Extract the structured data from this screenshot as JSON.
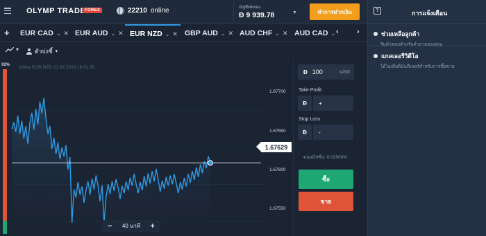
{
  "header": {
    "logo": "OLYMP TRADE",
    "logo_badge": "FOREX",
    "online_count": "22210",
    "online_label": "online",
    "account_label": "บัญชีทดลอง",
    "balance": "Ð 9 939.78",
    "deposit_label": "ทำการฝากเงิน"
  },
  "tabs": [
    {
      "label": "EUR CAD",
      "active": false
    },
    {
      "label": "EUR AUD",
      "active": false
    },
    {
      "label": "EUR NZD",
      "active": true
    },
    {
      "label": "GBP AUD",
      "active": false
    },
    {
      "label": "AUD CHF",
      "active": false
    },
    {
      "label": "AUD CAD",
      "active": false
    }
  ],
  "toolbar": {
    "indicators_label": "ตัวบ่งชี้"
  },
  "chart": {
    "caption": "online EUR NZD 21.02.2018 16:01:50",
    "percent_label": "92%",
    "current_price_label": "1.67629",
    "time_frame_label": "40 นาที",
    "y_ticks": [
      "1.67700",
      "1.67650",
      "1.67600",
      "1.67550"
    ]
  },
  "trade_panel": {
    "currency_symbol": "Ð",
    "amount": "100",
    "multiplier": "x200",
    "take_profit_label": "Take Profit",
    "stop_loss_label": "Stop Loss",
    "plus_sign": "+",
    "minus_sign": "-",
    "commission": "คอมมิชชั่น: 0.02500%",
    "buy_label": "ซื้อ",
    "sell_label": "ขาย"
  },
  "notifications": {
    "title": "การแจ้งเตือน",
    "items": [
      {
        "title": "ช่วยเหลือลูกค้า",
        "subtitle": "รับคำตอบสำหรับคำถามของคุณ"
      },
      {
        "title": "แกลเลอรีวิดีโอ",
        "subtitle": "ได้ไอเดียดีมันฟีเจอร์สำหรับการซื้อขาย"
      }
    ]
  },
  "colors": {
    "accent_blue": "#2f9be4",
    "deposit_orange": "#f39d1c",
    "buy_green": "#1fa773",
    "sell_red": "#e05438",
    "line_blue": "#2f9be4"
  },
  "icons": [
    "menu-icon",
    "globe-icon",
    "chevron-down-icon",
    "close-icon",
    "chevron-left-icon",
    "chevron-right-icon",
    "line-chart-icon",
    "person-icon",
    "help-icon",
    "chat-bubble-icon"
  ],
  "chart_data": {
    "type": "line",
    "ylim": [
      1.6753,
      1.6777
    ],
    "current_value": 1.67629,
    "x": [
      0,
      1,
      2,
      3,
      4,
      5,
      6,
      7,
      8,
      9,
      10,
      11,
      12,
      13,
      14,
      15,
      16,
      17,
      18,
      19,
      20,
      21,
      22,
      23,
      24,
      25,
      26,
      27,
      28,
      29,
      30,
      31,
      32,
      33,
      34,
      35,
      36,
      37,
      38,
      39,
      40,
      41,
      42,
      43,
      44,
      45,
      46,
      47,
      48,
      49,
      50,
      51,
      52,
      53,
      54,
      55,
      56,
      57,
      58,
      59,
      60,
      61,
      62,
      63,
      64,
      65,
      66,
      67,
      68,
      69,
      70,
      71,
      72,
      73,
      74,
      75,
      76,
      77,
      78,
      79,
      80,
      81,
      82,
      83,
      84,
      85,
      86,
      87,
      88,
      89,
      90,
      91,
      92,
      93,
      94,
      95,
      96,
      97,
      98,
      99
    ],
    "series": [
      {
        "values": [
          1.67675,
          1.67684,
          1.67671,
          1.67693,
          1.67668,
          1.67686,
          1.67662,
          1.67679,
          1.67655,
          1.67683,
          1.67697,
          1.67674,
          1.67702,
          1.67681,
          1.67712,
          1.67696,
          1.67717,
          1.6769,
          1.67668,
          1.67679,
          1.67648,
          1.67663,
          1.67641,
          1.67657,
          1.67634,
          1.6765,
          1.67638,
          1.67653,
          1.6762,
          1.67637,
          1.67548,
          1.67593,
          1.67582,
          1.67603,
          1.67586,
          1.67597,
          1.67575,
          1.67592,
          1.67604,
          1.67586,
          1.67608,
          1.67593,
          1.67612,
          1.67598,
          1.67577,
          1.67599,
          1.67548,
          1.67583,
          1.676,
          1.67587,
          1.67604,
          1.67591,
          1.67607,
          1.67596,
          1.6758,
          1.67598,
          1.67588,
          1.67604,
          1.67592,
          1.67609,
          1.67598,
          1.67614,
          1.676,
          1.67588,
          1.67603,
          1.67592,
          1.67611,
          1.67597,
          1.67615,
          1.67601,
          1.67618,
          1.67604,
          1.67621,
          1.67606,
          1.6759,
          1.67605,
          1.67594,
          1.6761,
          1.67598,
          1.67612,
          1.676,
          1.67614,
          1.67601,
          1.67588,
          1.67603,
          1.67593,
          1.67609,
          1.67597,
          1.67614,
          1.67602,
          1.67618,
          1.67606,
          1.67623,
          1.6761,
          1.67627,
          1.67615,
          1.67631,
          1.67622,
          1.67638,
          1.67629
        ]
      }
    ]
  }
}
